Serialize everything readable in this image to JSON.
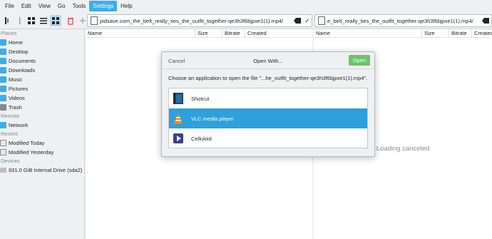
{
  "menubar": {
    "items": [
      {
        "label": "File"
      },
      {
        "label": "Edit"
      },
      {
        "label": "View"
      },
      {
        "label": "Go"
      },
      {
        "label": "Tools"
      },
      {
        "label": "Settings",
        "active": true
      },
      {
        "label": "Help"
      }
    ]
  },
  "toolbar": {
    "left_path": "pidsave.com_the_belt_really_ties_the_outfit_together-qe3h3f6bjpxe1(1).mp4/",
    "right_path": "e_belt_really_ties_the_outfit_together-qe3h3f6bjpxe1(1).mp4/"
  },
  "sidebar": {
    "places_header": "Places",
    "places": [
      {
        "label": "Home",
        "icon": "home-icon"
      },
      {
        "label": "Desktop",
        "icon": "desktop-icon"
      },
      {
        "label": "Documents",
        "icon": "documents-icon"
      },
      {
        "label": "Downloads",
        "icon": "downloads-icon"
      },
      {
        "label": "Music",
        "icon": "music-icon"
      },
      {
        "label": "Pictures",
        "icon": "pictures-icon"
      },
      {
        "label": "Videos",
        "icon": "videos-icon"
      },
      {
        "label": "Trash",
        "icon": "trash-icon"
      }
    ],
    "remote_header": "Remote",
    "remote": [
      {
        "label": "Network",
        "icon": "network-icon"
      }
    ],
    "recent_header": "Recent",
    "recent": [
      {
        "label": "Modified Today",
        "icon": "calendar-icon"
      },
      {
        "label": "Modified Yesterday",
        "icon": "calendar-icon"
      }
    ],
    "devices_header": "Devices",
    "devices": [
      {
        "label": "931.0 GiB Internal Drive (sda2)",
        "icon": "drive-icon"
      }
    ]
  },
  "left_pane": {
    "columns": [
      "Name",
      "Size",
      "Bitrate",
      "Created"
    ]
  },
  "right_pane": {
    "columns": [
      "Name",
      "Size",
      "Bitrate",
      "Created"
    ],
    "status": "Loading canceled"
  },
  "dialog": {
    "cancel_label": "Cancel",
    "title": "Open With...",
    "open_label": "Open",
    "description": "Choose an application to open the file \"...he_outfit_together-qe3h3f6bjpxe1(1).mp4\".",
    "apps": [
      {
        "label": "Shotcut",
        "icon": "shotcut-icon",
        "selected": false
      },
      {
        "label": "VLC media player",
        "icon": "vlc-icon",
        "selected": true
      },
      {
        "label": "Celluloid",
        "icon": "celluloid-icon",
        "selected": false
      }
    ]
  },
  "colors": {
    "accent": "#3daee9",
    "selection": "#2ea0dc",
    "open_button": "#6cc46b"
  }
}
